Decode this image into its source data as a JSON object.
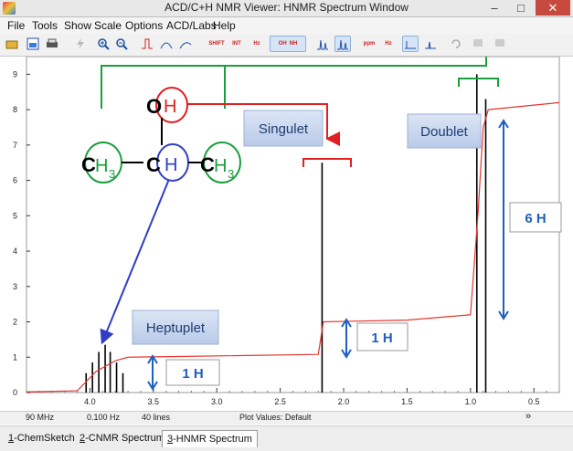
{
  "window": {
    "title": "ACD/C+H NMR Viewer: HNMR Spectrum Window",
    "minimize": "–",
    "maximize": "□",
    "close": "✕"
  },
  "menu": [
    "File",
    "Tools",
    "Show",
    "Scale",
    "Options",
    "ACD/Labs",
    "Help"
  ],
  "toolbar": {
    "icons": [
      "open-icon",
      "image-icon",
      "print-icon",
      "lightning-icon",
      "zoom-in-icon",
      "zoom-out-icon",
      "peak-icon",
      "curve-icon",
      "curve2-icon",
      "shift-icon",
      "int-icon",
      "hz-icon",
      "oh-nh-icon",
      "spectrum-icon",
      "spectrum2-icon",
      "ppm-icon",
      "hz-scale-icon",
      "baseline-icon",
      "baseline2-icon",
      "undo-icon",
      "export-icon",
      "export2-icon"
    ],
    "shift_label": "SHIFT",
    "int_label": "INT",
    "hz_label": "Hz",
    "oh_label": "OH",
    "nh_label": "NH",
    "ppm_label": "ppm"
  },
  "chart_data": {
    "type": "line",
    "xlabel": "",
    "ylabel": "",
    "xlim": [
      4.5,
      0.3
    ],
    "ylim": [
      0,
      9.5
    ],
    "x_ticks": [
      "4.0",
      "3.5",
      "3.0",
      "2.5",
      "2.0",
      "1.5",
      "1.0",
      "0.5"
    ],
    "y_ticks": [
      "0",
      "1",
      "2",
      "3",
      "4",
      "5",
      "6",
      "7",
      "8",
      "9"
    ],
    "peaks": [
      {
        "ppm": 4.03,
        "height": 0.55
      },
      {
        "ppm": 3.98,
        "height": 0.85
      },
      {
        "ppm": 3.93,
        "height": 1.15
      },
      {
        "ppm": 3.88,
        "height": 1.35
      },
      {
        "ppm": 3.84,
        "height": 1.15
      },
      {
        "ppm": 3.79,
        "height": 0.85
      },
      {
        "ppm": 3.74,
        "height": 0.55
      },
      {
        "ppm": 2.17,
        "height": 6.5
      },
      {
        "ppm": 0.95,
        "height": 9.0
      },
      {
        "ppm": 0.88,
        "height": 8.3
      }
    ],
    "integral": [
      [
        4.5,
        0.02
      ],
      [
        4.1,
        0.05
      ],
      [
        3.95,
        0.6
      ],
      [
        3.8,
        0.9
      ],
      [
        3.7,
        1.0
      ],
      [
        3.3,
        1.02
      ],
      [
        2.2,
        1.08
      ],
      [
        2.16,
        2.0
      ],
      [
        1.5,
        2.05
      ],
      [
        1.0,
        2.2
      ],
      [
        0.94,
        5.1
      ],
      [
        0.9,
        7.5
      ],
      [
        0.86,
        8.0
      ],
      [
        0.3,
        8.2
      ]
    ],
    "annotations": {
      "singlet": "Singulet",
      "doublet": "Doublet",
      "heptuplet": "Heptuplet",
      "h1a": "1 H",
      "h1b": "1 H",
      "h6": "6 H"
    },
    "structure": {
      "o": "O",
      "h_oh": "H",
      "c_left": "C",
      "h3_left": "H",
      "sub3_left": "3",
      "c_mid": "C",
      "h_mid": "H",
      "c_right": "C",
      "h3_right": "H",
      "sub3_right": "3"
    }
  },
  "status": {
    "freq": "90 MHz",
    "resolution": "0.100 Hz",
    "lines": "40 lines",
    "plot_values": "Plot Values: Default",
    "more": "»"
  },
  "tabs": [
    {
      "num": "1",
      "label": "-ChemSketch"
    },
    {
      "num": "2",
      "label": "-CNMR Spectrum"
    },
    {
      "num": "3",
      "label": "-HNMR Spectrum"
    }
  ],
  "colors": {
    "integral": "#e8352e",
    "peaks": "#000000",
    "green": "#1a9f3c",
    "red": "#e32020",
    "blue": "#2f3ec4",
    "label_box": "#c9d7ef",
    "arrow_blue": "#1f5fbf"
  }
}
